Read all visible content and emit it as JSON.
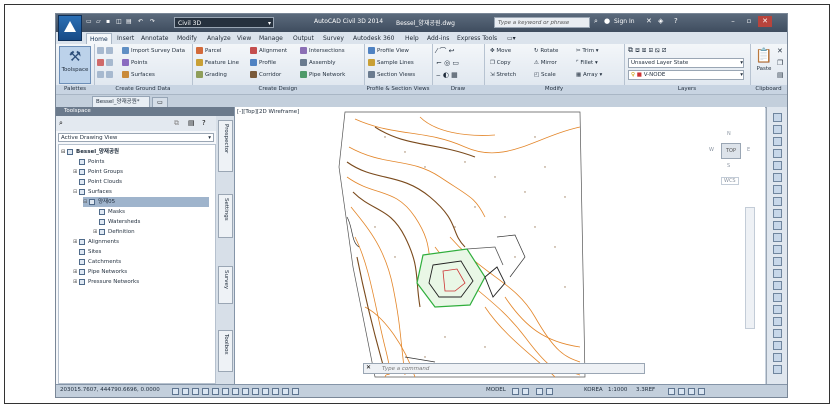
{
  "titlebar": {
    "workspace": "Civil 3D",
    "app_title": "AutoCAD Civil 3D 2014",
    "file_name": "Bessel_양재공원.dwg",
    "search_placeholder": "Type a keyword or phrase",
    "sign_in": "Sign In",
    "help": "?"
  },
  "menu_tabs": [
    "Home",
    "Insert",
    "Annotate",
    "Modify",
    "Analyze",
    "View",
    "Manage",
    "Output",
    "Survey",
    "Autodesk 360",
    "Help",
    "Add-ins",
    "Express Tools"
  ],
  "ribbon": {
    "palettes": {
      "big_button": "Toolspace",
      "title": "Palettes"
    },
    "ground_data": {
      "items": [
        "Import Survey Data",
        "Points",
        "Surfaces"
      ],
      "title": "Create Ground Data"
    },
    "design": {
      "items": [
        "Parcel",
        "Feature Line",
        "Grading",
        "Alignment",
        "Profile",
        "Corridor",
        "Intersections",
        "Assembly",
        "Pipe Network"
      ],
      "title": "Create Design"
    },
    "profile_section": {
      "items": [
        "Profile View",
        "Sample Lines",
        "Section Views"
      ],
      "title": "Profile & Section Views"
    },
    "draw": {
      "title": "Draw"
    },
    "modify": {
      "items": [
        "Move",
        "Copy",
        "Stretch",
        "Rotate",
        "Mirror",
        "Scale",
        "Trim",
        "Fillet",
        "Array"
      ],
      "title": "Modify"
    },
    "layers": {
      "state": "Unsaved Layer State",
      "layer": "V-NODE",
      "title": "Layers"
    },
    "clipboard": {
      "big_button": "Paste",
      "title": "Clipboard"
    }
  },
  "document": {
    "tab": "Bessel_양재공원*"
  },
  "toolspace": {
    "title": "Toolspace",
    "view": "Active Drawing View",
    "tree": [
      {
        "label": "Bessel_양재공원",
        "level": 0
      },
      {
        "label": "Points",
        "level": 1
      },
      {
        "label": "Point Groups",
        "level": 1
      },
      {
        "label": "Point Clouds",
        "level": 1
      },
      {
        "label": "Surfaces",
        "level": 1
      },
      {
        "label": "양재05",
        "level": 2
      },
      {
        "label": "Masks",
        "level": 3
      },
      {
        "label": "Watersheds",
        "level": 3
      },
      {
        "label": "Definition",
        "level": 3
      },
      {
        "label": "Alignments",
        "level": 1
      },
      {
        "label": "Sites",
        "level": 1
      },
      {
        "label": "Catchments",
        "level": 1
      },
      {
        "label": "Pipe Networks",
        "level": 1
      },
      {
        "label": "Pressure Networks",
        "level": 1
      }
    ],
    "side_tabs": [
      "Prospector",
      "Settings",
      "Survey",
      "Toolbox"
    ]
  },
  "viewport": {
    "label": "[-][Top][2D Wireframe]",
    "viewcube": {
      "face": "TOP",
      "north": "N",
      "south": "S",
      "east": "E",
      "west": "W",
      "wcs": "WCS"
    },
    "command_placeholder": "Type a command"
  },
  "status_bar": {
    "coords": "203015.7607, 444790.6696, 0.0000",
    "model": "MODEL",
    "locale": "KOREA",
    "scale": "1:1000",
    "xref": "3.3REF"
  },
  "colors": {
    "ribbon_bg": "#e6ecf3",
    "title_bg": "#4a586a",
    "contour_orange": "#e3862a",
    "contour_brown": "#7a4a1c",
    "green": "#2fae3c"
  }
}
